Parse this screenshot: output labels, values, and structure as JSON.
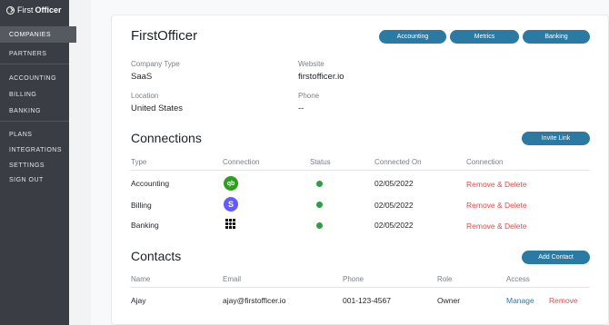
{
  "sidebar": {
    "logo": {
      "first": "First",
      "officer": "Officer"
    },
    "items": [
      {
        "label": "COMPANIES",
        "active": true
      },
      {
        "label": "PARTNERS"
      },
      {
        "label": "ACCOUNTING"
      },
      {
        "label": "BILLING"
      },
      {
        "label": "BANKING"
      },
      {
        "label": "PLANS"
      },
      {
        "label": "INTEGRATIONS"
      },
      {
        "label": "SETTINGS"
      },
      {
        "label": "SIGN OUT"
      }
    ]
  },
  "company": {
    "name": "FirstOfficer",
    "buttons": [
      "Accounting",
      "Metrics",
      "Banking"
    ],
    "type_label": "Company Type",
    "type_value": "SaaS",
    "website_label": "Website",
    "website_value": "firstofficer.io",
    "location_label": "Location",
    "location_value": "United States",
    "phone_label": "Phone",
    "phone_value": "--"
  },
  "connections": {
    "title": "Connections",
    "invite_label": "Invite Link",
    "headers": [
      "Type",
      "Connection",
      "Status",
      "Connected On",
      "Connection"
    ],
    "rows": [
      {
        "type": "Accounting",
        "icon": "quickbooks-icon",
        "date": "02/05/2022",
        "action": "Remove & Delete",
        "status_color": "#2f9d47"
      },
      {
        "type": "Billing",
        "icon": "stripe-icon",
        "date": "02/05/2022",
        "action": "Remove & Delete",
        "status_color": "#2f9d47"
      },
      {
        "type": "Banking",
        "icon": "plaid-icon",
        "date": "02/05/2022",
        "action": "Remove & Delete",
        "status_color": "#2f9d47"
      }
    ],
    "icons": {
      "quickbooks": "qb",
      "stripe": "S"
    }
  },
  "contacts": {
    "title": "Contacts",
    "add_label": "Add Contact",
    "headers": [
      "Name",
      "Email",
      "Phone",
      "Role",
      "Access"
    ],
    "rows": [
      {
        "name": "Ajay",
        "email": "ajay@firstofficer.io",
        "phone": "001-123-4567",
        "role": "Owner",
        "manage": "Manage",
        "remove": "Remove"
      }
    ]
  },
  "colors": {
    "accent": "#2a7aa3",
    "danger": "#e24b4b",
    "success": "#2f9d47",
    "sidebar": "#3a3e44"
  }
}
